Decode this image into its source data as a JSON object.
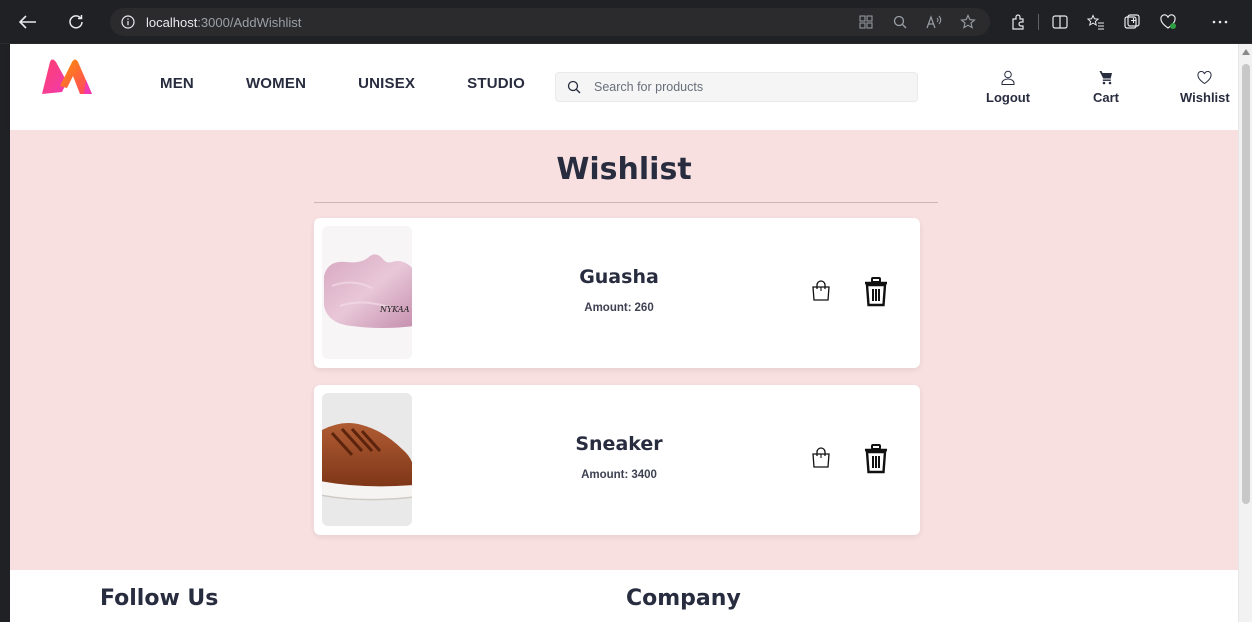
{
  "browser": {
    "url_host": "localhost",
    "url_path": ":3000/AddWishlist"
  },
  "header": {
    "nav": [
      "MEN",
      "WOMEN",
      "UNISEX",
      "STUDIO"
    ],
    "search_placeholder": "Search for products",
    "actions": {
      "logout": "Logout",
      "cart": "Cart",
      "wishlist": "Wishlist"
    }
  },
  "page": {
    "title": "Wishlist",
    "items": [
      {
        "name": "Guasha",
        "amount_label": "Amount:",
        "amount": "260",
        "image_icon": "guasha-stone-image"
      },
      {
        "name": "Sneaker",
        "amount_label": "Amount:",
        "amount": "3400",
        "image_icon": "sneaker-image"
      }
    ]
  },
  "footer": {
    "follow_us": "Follow Us",
    "company": "Company"
  },
  "colors": {
    "page_bg": "#f8e0e1",
    "text_dark": "#282c3f"
  }
}
